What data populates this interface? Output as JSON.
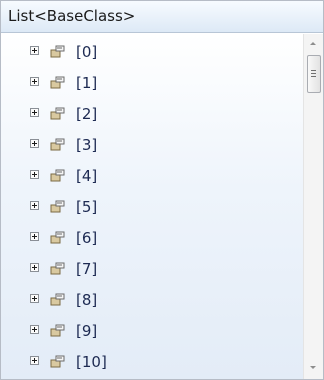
{
  "window": {
    "title": "List<BaseClass>"
  },
  "tree": {
    "expander_icon": "plus-box-icon",
    "item_icon": "property-icon",
    "items": [
      {
        "label": "[0]"
      },
      {
        "label": "[1]"
      },
      {
        "label": "[2]"
      },
      {
        "label": "[3]"
      },
      {
        "label": "[4]"
      },
      {
        "label": "[5]"
      },
      {
        "label": "[6]"
      },
      {
        "label": "[7]"
      },
      {
        "label": "[8]"
      },
      {
        "label": "[9]"
      },
      {
        "label": "[10]"
      }
    ]
  },
  "colors": {
    "header_bg": "#e4eef8",
    "border": "#b6bcc6",
    "item_text": "#1d2a52"
  }
}
